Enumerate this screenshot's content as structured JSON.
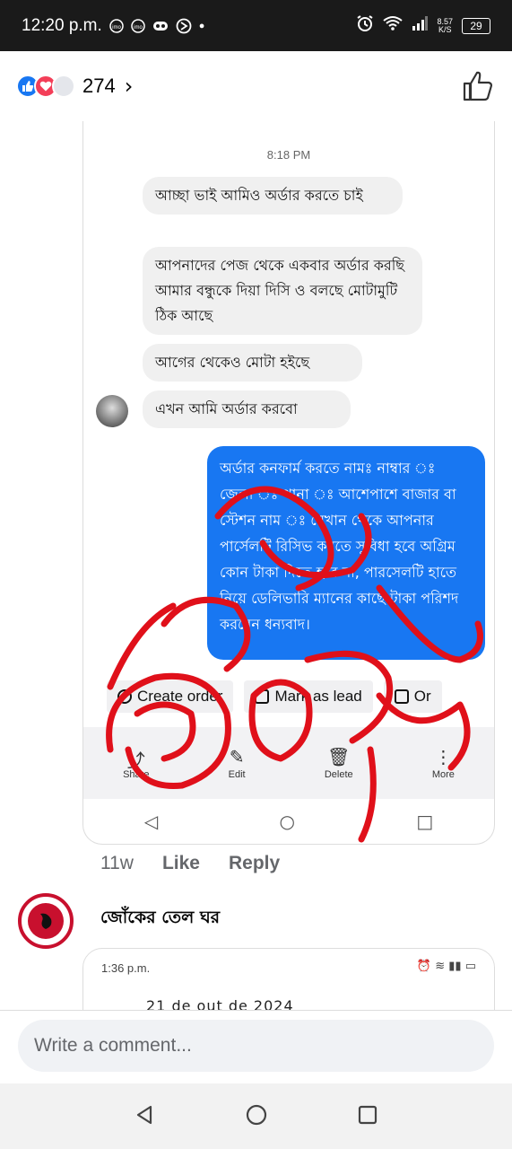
{
  "status_bar": {
    "time": "12:20 p.m.",
    "left_icons": [
      "imo",
      "imo",
      "game-controller",
      "data-saver",
      "dot"
    ],
    "net_speed_value": "8.57",
    "net_speed_unit": "K/S",
    "battery": "29"
  },
  "header": {
    "reactions": [
      "like",
      "love",
      "more"
    ],
    "reaction_count": "274",
    "chevron": "›"
  },
  "screenshot1": {
    "timestamp": "8:18 PM",
    "messages": [
      "আচ্ছা ভাই আমিও অর্ডার করতে চাই",
      "আপনাদের পেজ থেকে একবার অর্ডার করছি আমার বন্ধুকে দিয়া দিসি ও বলছে মোটামুটি ঠিক আছে",
      "আগের থেকেও মোটা হইছে",
      "এখন আমি অর্ডার করবো"
    ],
    "reply": "অর্ডার কনফার্ম করতে নামঃ নাম্বার ঃ জেলা ঃ থানা ঃ আশেপাশে বাজার বা স্টেশন নাম ঃ যেখান থেকে আপনার পার্সেলটি রিসিভ করতে সুবিধা হবে অগ্রিম কোন টাকা দিতে হবে না, পারসেলটি হাতে নিয়ে ডেলিভারি ম্যানের কাছে টাকা পরিশদ করবেন ধন্যবাদ।",
    "actions": [
      "Create order",
      "Mark as lead",
      "Or"
    ],
    "bottom_bar": [
      "Share",
      "Edit",
      "Delete",
      "More"
    ]
  },
  "comment_meta": {
    "age": "11w",
    "like": "Like",
    "reply": "Reply"
  },
  "comment2": {
    "author": "জোঁকের তেল ঘর"
  },
  "screenshot2": {
    "status_time": "1:36 p.m.",
    "peek_text": "21 de out de 2024"
  },
  "composer": {
    "placeholder": "Write a comment..."
  },
  "colors": {
    "messenger_blue": "#1877f2",
    "scribble_red": "#e0101a",
    "status_bar": "#1a1a1a"
  }
}
